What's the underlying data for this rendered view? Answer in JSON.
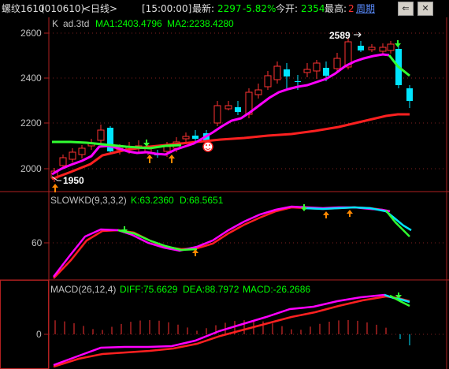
{
  "header": {
    "instrument": "螺纹1610",
    "code": "(010610)",
    "period": "<日线>",
    "time": "[15:00:00]",
    "last_label": "最新:",
    "last_value": "2297",
    "change_pct": "-5.82%",
    "open_label": "今开:",
    "open_value": "2354",
    "high_label": "最高:",
    "high_value": "2",
    "cycle_label": "周期",
    "btn_back_glyph": "⇐",
    "btn_close_glyph": "✕"
  },
  "price_panel": {
    "type_label": "K",
    "adjust_label": "ad.3td",
    "ma1_label": "MA1:2403.4796",
    "ma2_label": "MA2:2238.4280",
    "y_ticks": [
      "2600",
      "2400",
      "2200",
      "2000"
    ],
    "high_marker": "2589",
    "low_marker": "1950"
  },
  "kd_panel": {
    "name": "SLOWKD(9,3,3,2)",
    "k_label": "K:63.2360",
    "d_label": "D:68.5651",
    "y_ticks": [
      "60"
    ]
  },
  "macd_panel": {
    "name": "MACD(26,12,4)",
    "diff_label": "DIFF:75.6629",
    "dea_label": "DEA:88.7972",
    "macd_label": "MACD:-26.2686",
    "y_ticks": [
      "0"
    ]
  },
  "colors": {
    "up": "#ff3232",
    "down": "#00e5ff",
    "ma1": "#ff00ff",
    "ma2": "#ff2020",
    "kd_k": "#ff00ff",
    "kd_d": "#ff2020",
    "signal_green": "#32ff32",
    "axis": "#b02020",
    "text_yellow": "#ffff00",
    "text_green": "#00ff00",
    "text_cyan": "#00ffff"
  }
}
